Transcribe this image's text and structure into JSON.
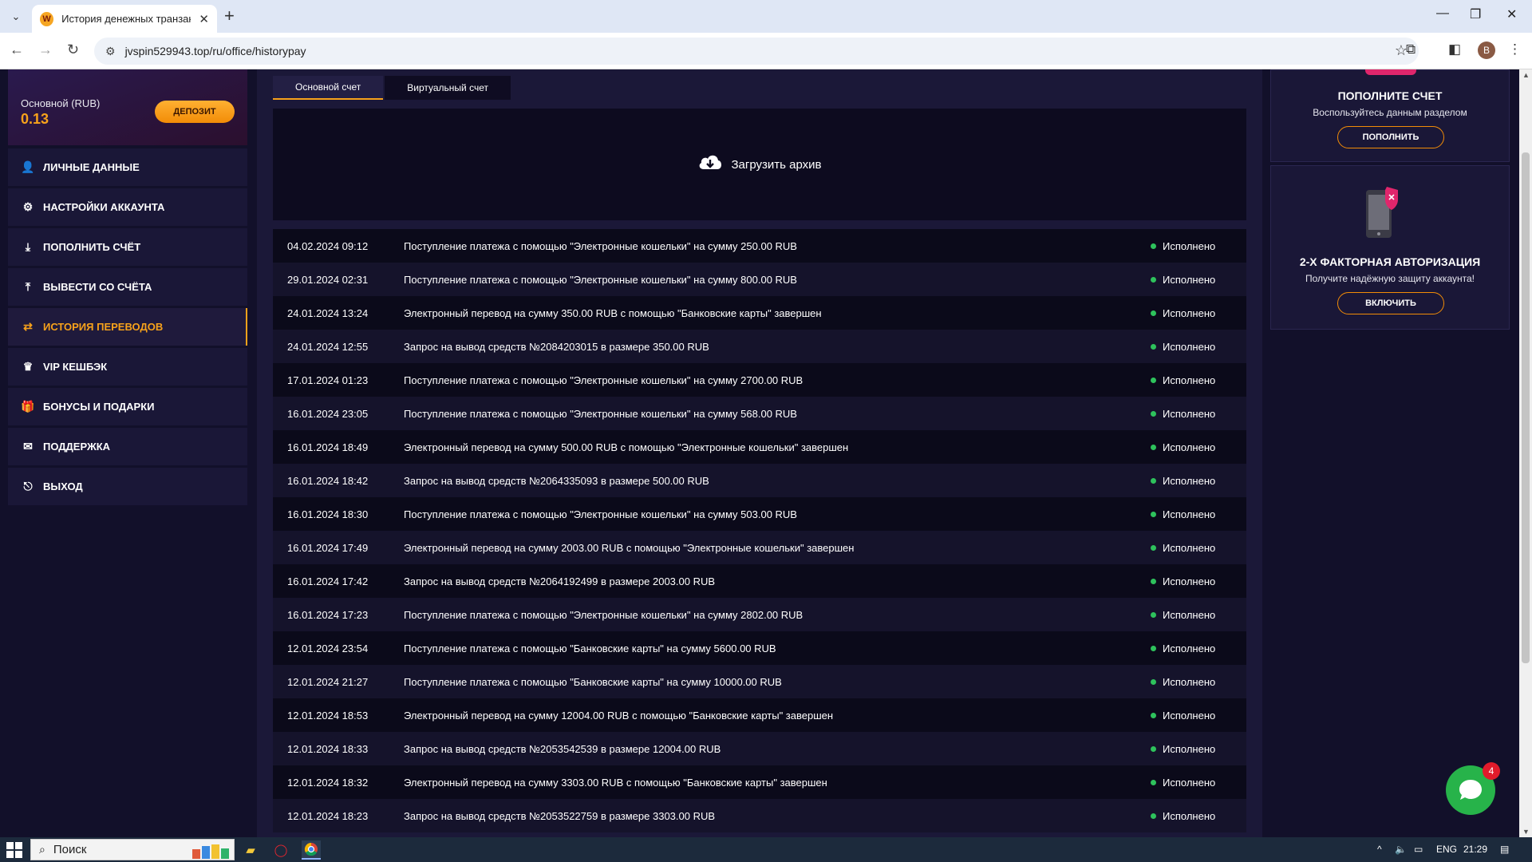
{
  "browser": {
    "tab_title": "История денежных транзакций",
    "url": "jvspin529943.top/ru/office/historypay",
    "profile_letter": "B"
  },
  "sidebar": {
    "balance_label": "Основной (RUB)",
    "balance_value": "0.13",
    "deposit_button": "ДЕПОЗИТ",
    "items": [
      {
        "label": "ЛИЧНЫЕ ДАННЫЕ",
        "icon": "user-gear-icon",
        "active": false
      },
      {
        "label": "НАСТРОЙКИ АККАУНТА",
        "icon": "gears-icon",
        "active": false
      },
      {
        "label": "ПОПОЛНИТЬ СЧЁТ",
        "icon": "download-icon",
        "active": false
      },
      {
        "label": "ВЫВЕСТИ СО СЧЁТА",
        "icon": "upload-icon",
        "active": false
      },
      {
        "label": "ИСТОРИЯ ПЕРЕВОДОВ",
        "icon": "transfer-icon",
        "active": true
      },
      {
        "label": "VIP КЕШБЭК",
        "icon": "crown-icon",
        "active": false
      },
      {
        "label": "БОНУСЫ И ПОДАРКИ",
        "icon": "gift-icon",
        "active": false
      },
      {
        "label": "ПОДДЕРЖКА",
        "icon": "envelope-icon",
        "active": false
      },
      {
        "label": "ВЫХОД",
        "icon": "sign-out-icon",
        "active": false
      }
    ]
  },
  "main": {
    "tabs": [
      {
        "label": "Основной счет",
        "active": true
      },
      {
        "label": "Виртуальный счет",
        "active": false
      }
    ],
    "archive_label": "Загрузить архив",
    "transactions": [
      {
        "date": "04.02.2024 09:12",
        "desc": "Поступление платежа с помощью \"Электронные кошельки\" на сумму 250.00 RUB",
        "status": "Исполнено"
      },
      {
        "date": "29.01.2024 02:31",
        "desc": "Поступление платежа с помощью \"Электронные кошельки\" на сумму 800.00 RUB",
        "status": "Исполнено"
      },
      {
        "date": "24.01.2024 13:24",
        "desc": "Электронный перевод на сумму 350.00 RUB с помощью \"Банковские карты\" завершен",
        "status": "Исполнено"
      },
      {
        "date": "24.01.2024 12:55",
        "desc": "Запрос на вывод средств №2084203015 в размере 350.00 RUB",
        "status": "Исполнено"
      },
      {
        "date": "17.01.2024 01:23",
        "desc": "Поступление платежа с помощью \"Электронные кошельки\" на сумму 2700.00 RUB",
        "status": "Исполнено"
      },
      {
        "date": "16.01.2024 23:05",
        "desc": "Поступление платежа с помощью \"Электронные кошельки\" на сумму 568.00 RUB",
        "status": "Исполнено"
      },
      {
        "date": "16.01.2024 18:49",
        "desc": "Электронный перевод на сумму 500.00 RUB с помощью \"Электронные кошельки\" завершен",
        "status": "Исполнено"
      },
      {
        "date": "16.01.2024 18:42",
        "desc": "Запрос на вывод средств №2064335093 в размере 500.00 RUB",
        "status": "Исполнено"
      },
      {
        "date": "16.01.2024 18:30",
        "desc": "Поступление платежа с помощью \"Электронные кошельки\" на сумму 503.00 RUB",
        "status": "Исполнено"
      },
      {
        "date": "16.01.2024 17:49",
        "desc": "Электронный перевод на сумму 2003.00 RUB с помощью \"Электронные кошельки\" завершен",
        "status": "Исполнено"
      },
      {
        "date": "16.01.2024 17:42",
        "desc": "Запрос на вывод средств №2064192499 в размере 2003.00 RUB",
        "status": "Исполнено"
      },
      {
        "date": "16.01.2024 17:23",
        "desc": "Поступление платежа с помощью \"Электронные кошельки\" на сумму 2802.00 RUB",
        "status": "Исполнено"
      },
      {
        "date": "12.01.2024 23:54",
        "desc": "Поступление платежа с помощью \"Банковские карты\" на сумму 5600.00 RUB",
        "status": "Исполнено"
      },
      {
        "date": "12.01.2024 21:27",
        "desc": "Поступление платежа с помощью \"Банковские карты\" на сумму 10000.00 RUB",
        "status": "Исполнено"
      },
      {
        "date": "12.01.2024 18:53",
        "desc": "Электронный перевод на сумму 12004.00 RUB с помощью \"Банковские карты\" завершен",
        "status": "Исполнено"
      },
      {
        "date": "12.01.2024 18:33",
        "desc": "Запрос на вывод средств №2053542539 в размере 12004.00 RUB",
        "status": "Исполнено"
      },
      {
        "date": "12.01.2024 18:32",
        "desc": "Электронный перевод на сумму 3303.00 RUB с помощью \"Банковские карты\" завершен",
        "status": "Исполнено"
      },
      {
        "date": "12.01.2024 18:23",
        "desc": "Запрос на вывод средств №2053522759 в размере 3303.00 RUB",
        "status": "Исполнено"
      }
    ]
  },
  "right": {
    "promo1": {
      "title": "ПОПОЛНИТЕ СЧЕТ",
      "subtitle": "Воспользуйтесь данным разделом",
      "button": "ПОПОЛНИТЬ"
    },
    "promo2": {
      "title": "2-Х ФАКТОРНАЯ АВТОРИЗАЦИЯ",
      "subtitle": "Получите надёжную защиту аккаунта!",
      "button": "ВКЛЮЧИТЬ"
    }
  },
  "chat": {
    "badge": "4"
  },
  "taskbar": {
    "search_placeholder": "Поиск",
    "lang": "ENG",
    "time": "21:29"
  },
  "colors": {
    "accent": "#f7a21b",
    "status_ok": "#2ec25c",
    "bg": "#12102a"
  }
}
